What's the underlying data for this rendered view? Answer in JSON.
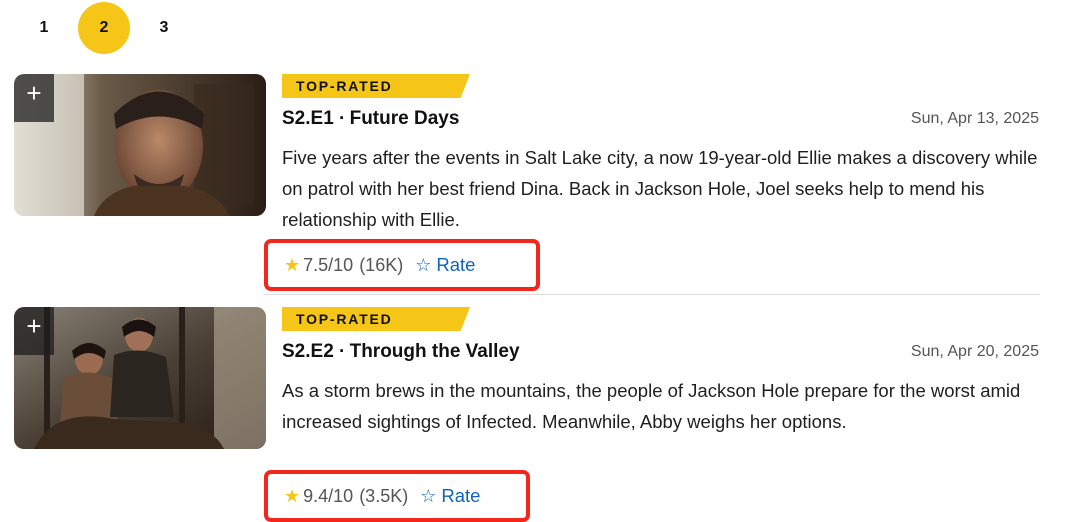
{
  "pager": {
    "pages": [
      "1",
      "2",
      "3"
    ],
    "active": "2"
  },
  "episodes": [
    {
      "badge": "TOP-RATED",
      "title": "S2.E1 ∙ Future Days",
      "date": "Sun, Apr 13, 2025",
      "description": "Five years after the events in Salt Lake city, a now 19-year-old Ellie makes a discovery while on patrol with her best friend Dina. Back in Jackson Hole, Joel seeks help to mend his relationship with Ellie.",
      "rating": "7.5/10",
      "votes": "(16K)",
      "rate_label": "Rate",
      "add_label": "+"
    },
    {
      "badge": "TOP-RATED",
      "title": "S2.E2 ∙ Through the Valley",
      "date": "Sun, Apr 20, 2025",
      "description": "As a storm brews in the mountains, the people of Jackson Hole prepare for the worst amid increased sightings of Infected. Meanwhile, Abby weighs her options.",
      "rating": "9.4/10",
      "votes": "(3.5K)",
      "rate_label": "Rate",
      "add_label": "+"
    }
  ],
  "colors": {
    "accent": "#f5c518",
    "highlight_box": "#f2261b",
    "link": "#0e63be"
  },
  "icons": {
    "star": "star-icon",
    "rate": "star-outline-icon",
    "add": "plus-icon"
  }
}
